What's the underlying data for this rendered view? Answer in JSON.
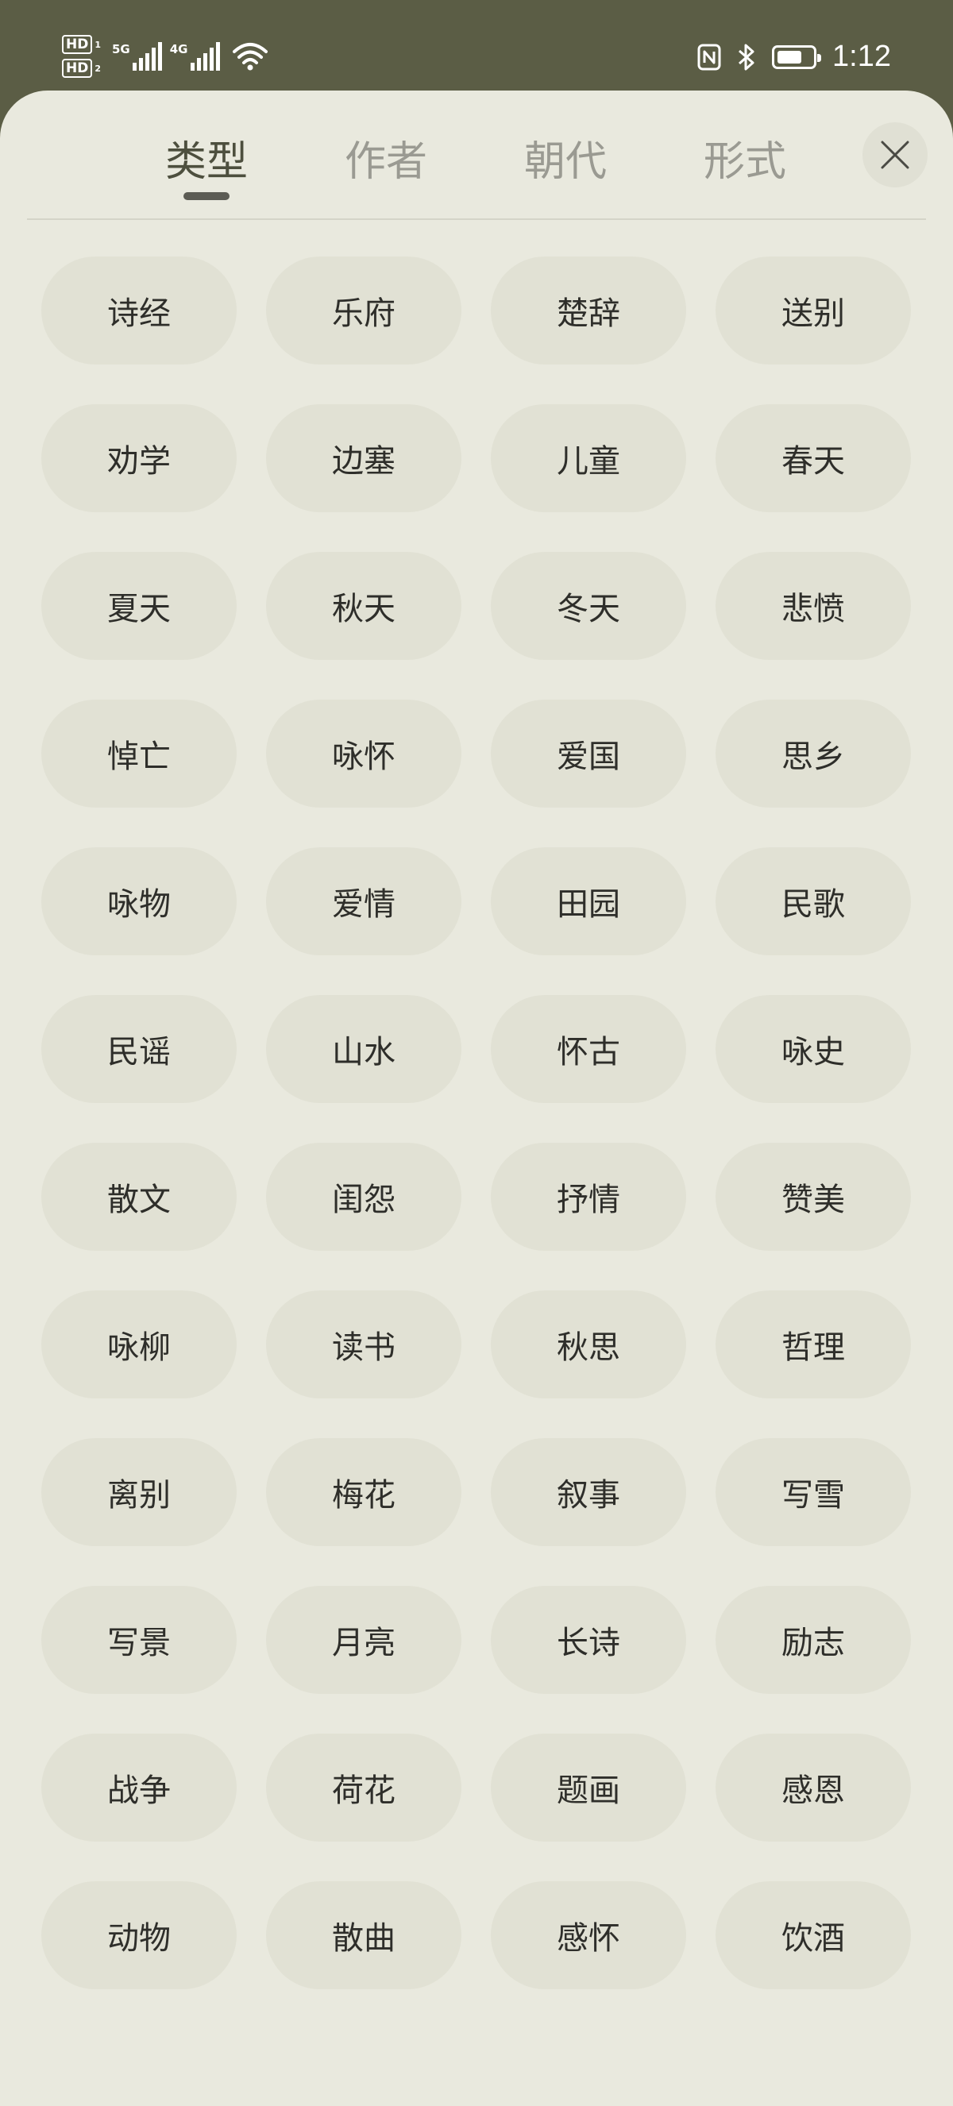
{
  "status_bar": {
    "hd1": "HD",
    "hd1_sub": "1",
    "hd2": "HD",
    "hd2_sub": "2",
    "net1": "5G",
    "net2": "4G",
    "battery_level": 0.72,
    "time": "1:12"
  },
  "tabs": [
    {
      "label": "类型",
      "active": true
    },
    {
      "label": "作者",
      "active": false
    },
    {
      "label": "朝代",
      "active": false
    },
    {
      "label": "形式",
      "active": false
    }
  ],
  "close_icon": "close-icon",
  "categories": [
    "诗经",
    "乐府",
    "楚辞",
    "送别",
    "劝学",
    "边塞",
    "儿童",
    "春天",
    "夏天",
    "秋天",
    "冬天",
    "悲愤",
    "悼亡",
    "咏怀",
    "爱国",
    "思乡",
    "咏物",
    "爱情",
    "田园",
    "民歌",
    "民谣",
    "山水",
    "怀古",
    "咏史",
    "散文",
    "闺怨",
    "抒情",
    "赞美",
    "咏柳",
    "读书",
    "秋思",
    "哲理",
    "离别",
    "梅花",
    "叙事",
    "写雪",
    "写景",
    "月亮",
    "长诗",
    "励志",
    "战争",
    "荷花",
    "题画",
    "感恩",
    "动物",
    "散曲",
    "感怀",
    "饮酒"
  ],
  "colors": {
    "header_bg": "#5b5d45",
    "sheet_bg": "#e9e9de",
    "chip_bg": "#e1e1d4",
    "active_tab": "#4d4f3e",
    "inactive_tab": "#9a9a92"
  }
}
